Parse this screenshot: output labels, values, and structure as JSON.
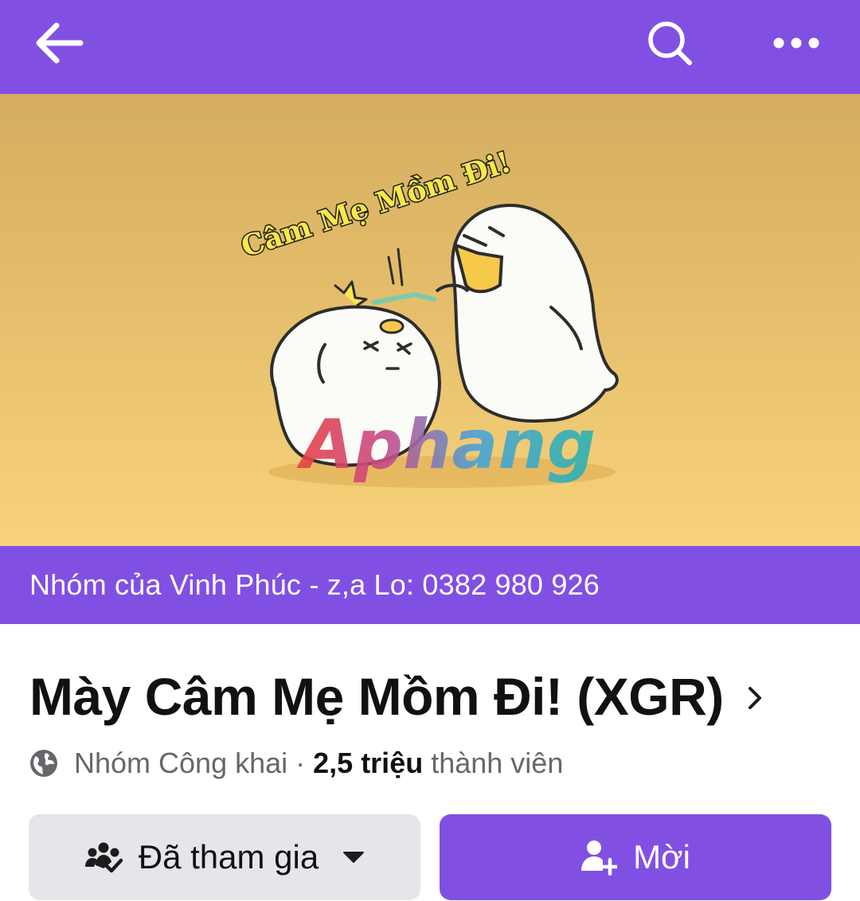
{
  "topbar": {
    "back_icon": "arrow-left-icon",
    "search_icon": "search-icon",
    "more_icon": "more-horizontal-icon",
    "color": "#8150e3"
  },
  "cover": {
    "caption": "Câm Mẹ Mồm Đi!",
    "watermark": "Aphang",
    "background_top": "#d4ad5f",
    "background_bottom": "#f8d27a"
  },
  "banner": {
    "text": "Nhóm của Vinh Phúc - z,a Lo: 0382 980 926"
  },
  "group": {
    "title": "Mày Câm Mẹ Mồm Đi! (XGR)",
    "privacy": "Nhóm Công khai",
    "separator": "·",
    "member_count": "2,5 triệu",
    "member_label": "thành viên"
  },
  "actions": {
    "joined_label": "Đã tham gia",
    "joined_icon": "group-check-icon",
    "invite_label": "Mời",
    "invite_icon": "add-person-icon"
  }
}
